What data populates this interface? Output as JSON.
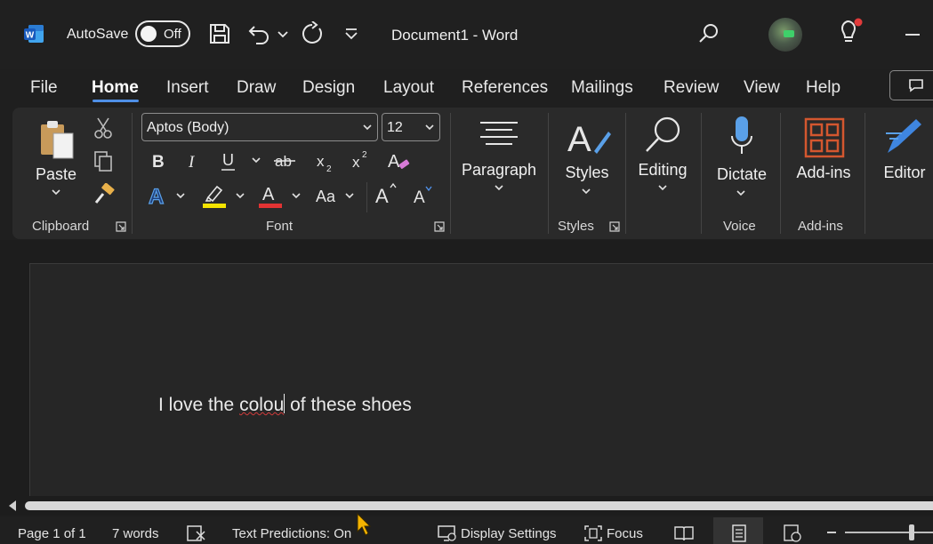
{
  "app": {
    "autosave_label": "AutoSave",
    "autosave_state": "Off",
    "document_title": "Document1  -  Word",
    "icons": [
      "word-logo-icon",
      "save-icon",
      "undo-icon",
      "chevron-down-icon",
      "redo-icon",
      "customize-toolbar-icon",
      "search-icon",
      "lightbulb-icon",
      "minimize-icon"
    ]
  },
  "tabs": [
    "File",
    "Home",
    "Insert",
    "Draw",
    "Design",
    "Layout",
    "References",
    "Mailings",
    "Review",
    "View",
    "Help"
  ],
  "active_tab": "Home",
  "ribbon": {
    "clipboard": {
      "paste_label": "Paste",
      "group_label": "Clipboard"
    },
    "font": {
      "font_name": "Aptos (Body)",
      "font_size": "12",
      "group_label": "Font"
    },
    "paragraph": {
      "label": "Paragraph"
    },
    "styles": {
      "label": "Styles",
      "group_label": "Styles"
    },
    "editing": {
      "label": "Editing"
    },
    "voice": {
      "label": "Dictate",
      "group_label": "Voice"
    },
    "addins": {
      "label": "Add-ins",
      "group_label": "Add-ins"
    },
    "editor": {
      "label": "Editor"
    }
  },
  "document": {
    "text_before": "I love the ",
    "misspelled": "colou",
    "text_after": "of these shoes"
  },
  "status": {
    "page": "Page 1 of 1",
    "words": "7 words",
    "text_predictions": "Text Predictions: On",
    "display_settings": "Display Settings",
    "focus": "Focus"
  },
  "colors": {
    "accent": "#4f8fe6",
    "highlight": "#f5e400",
    "font_color": "#e23333",
    "addins_icon": "#d4572f",
    "dictate_icon": "#5aa0e8"
  }
}
